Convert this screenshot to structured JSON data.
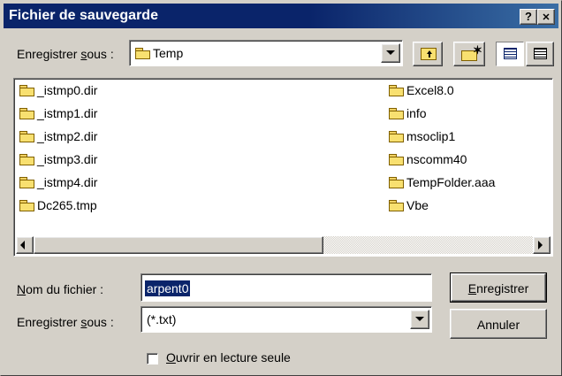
{
  "window": {
    "title": "Fichier de sauvegarde",
    "help_label": "?",
    "close_label": "✕"
  },
  "save_in": {
    "label_before": "Enregistrer ",
    "label_hotkey": "s",
    "label_after": "ous :",
    "value": "Temp"
  },
  "files": {
    "column1": [
      {
        "name": "_istmp0.dir",
        "type": "folder"
      },
      {
        "name": "_istmp1.dir",
        "type": "folder"
      },
      {
        "name": "_istmp2.dir",
        "type": "folder"
      },
      {
        "name": "_istmp3.dir",
        "type": "folder"
      },
      {
        "name": "_istmp4.dir",
        "type": "folder"
      },
      {
        "name": "Dc265.tmp",
        "type": "folder"
      }
    ],
    "column2": [
      {
        "name": "Excel8.0",
        "type": "folder"
      },
      {
        "name": "info",
        "type": "folder"
      },
      {
        "name": "msoclip1",
        "type": "folder"
      },
      {
        "name": "nscomm40",
        "type": "folder"
      },
      {
        "name": "TempFolder.aaa",
        "type": "folder"
      },
      {
        "name": "Vbe",
        "type": "folder"
      }
    ]
  },
  "filename": {
    "label_hotkey": "N",
    "label_after": "om du fichier :",
    "value": "arpent0"
  },
  "filetype": {
    "label_before": "Enregistrer ",
    "label_hotkey": "s",
    "label_after": "ous :",
    "value": "(*.txt)"
  },
  "buttons": {
    "save_hotkey": "E",
    "save_after": "nregistrer",
    "cancel": "Annuler"
  },
  "readonly": {
    "hotkey": "O",
    "label_after": "uvrir en lecture seule",
    "checked": false
  },
  "colors": {
    "title_bar": "#0a246a",
    "face": "#d4d0c8",
    "selection": "#0a246a"
  }
}
